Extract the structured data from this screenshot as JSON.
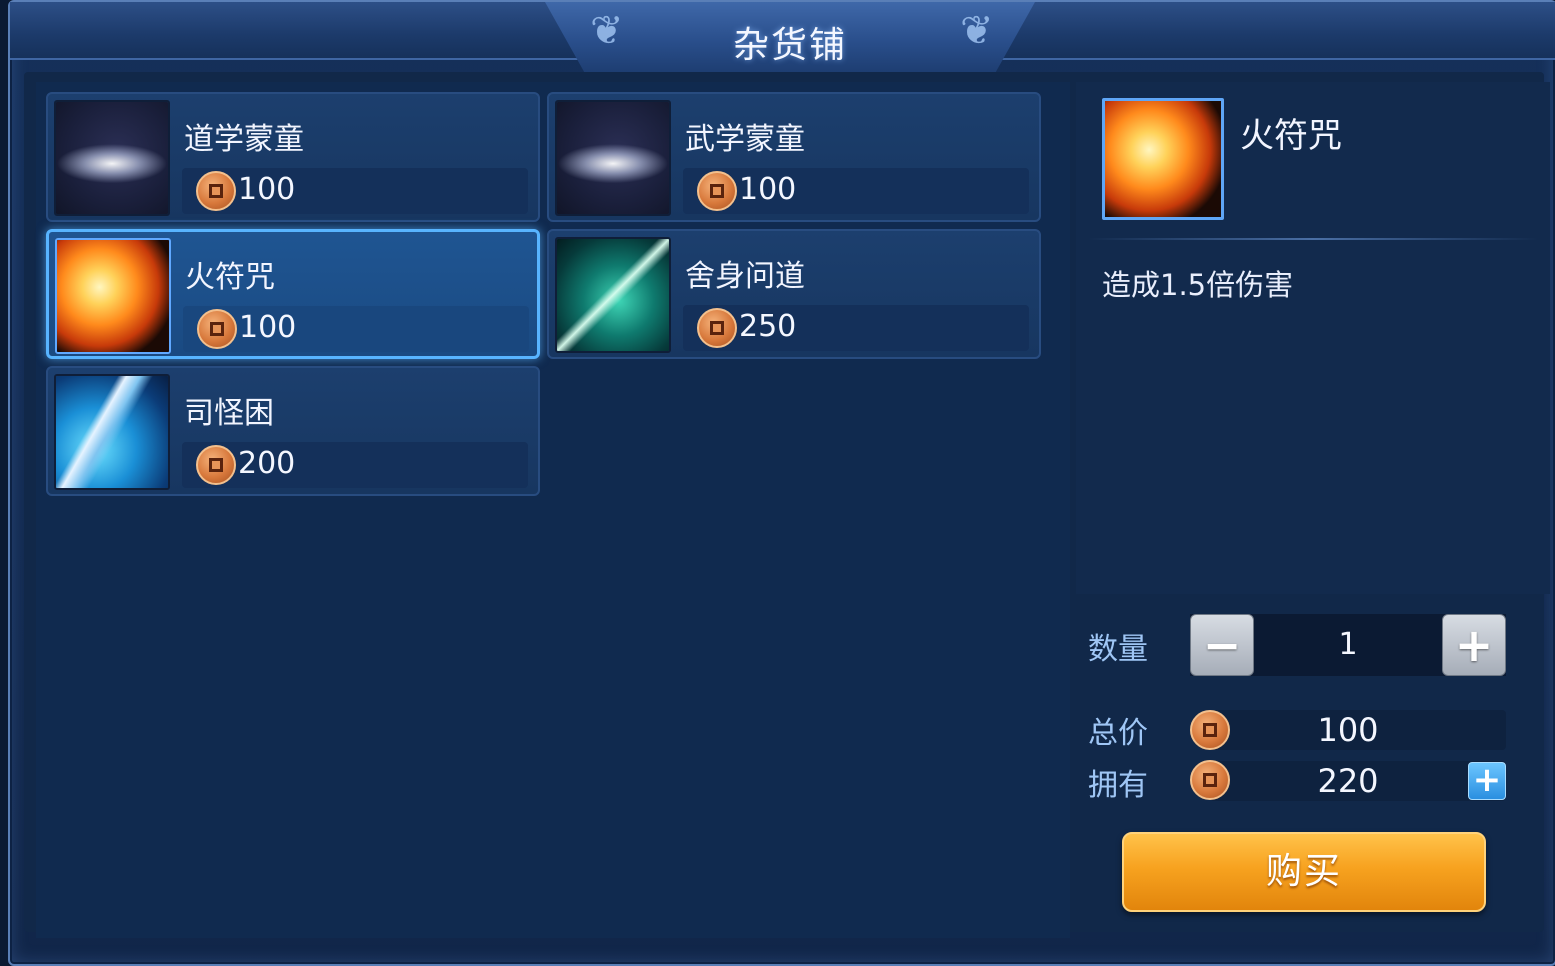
{
  "window_title": "杂货铺",
  "items": [
    {
      "name": "道学蒙童",
      "price": "100",
      "icon": "swirl-skill-icon",
      "selected": false
    },
    {
      "name": "武学蒙童",
      "price": "100",
      "icon": "swirl-skill-icon",
      "selected": false
    },
    {
      "name": "火符咒",
      "price": "100",
      "icon": "fire-skill-icon",
      "selected": true
    },
    {
      "name": "舍身问道",
      "price": "250",
      "icon": "green-sword-skill-icon",
      "selected": false
    },
    {
      "name": "司怪困",
      "price": "200",
      "icon": "blade-skill-icon",
      "selected": false
    }
  ],
  "detail": {
    "name": "火符咒",
    "description": "造成1.5倍伤害",
    "icon": "fire-skill-icon"
  },
  "purchase": {
    "quantity_label": "数量",
    "quantity": "1",
    "minus_symbol": "−",
    "plus_symbol": "+",
    "total_label": "总价",
    "total": "100",
    "owned_label": "拥有",
    "owned": "220",
    "add_currency_symbol": "+",
    "buy_label": "购买"
  },
  "colors": {
    "selected_border": "#58b4ff",
    "buy_button": "#f7a21f",
    "coin": "#d8793c"
  }
}
